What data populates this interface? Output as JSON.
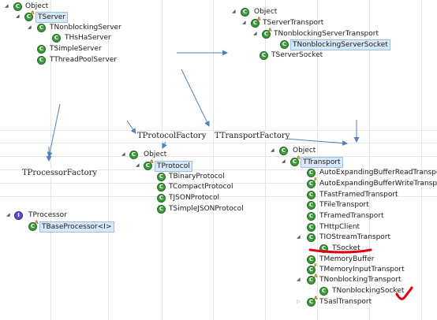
{
  "factories": {
    "protocol": "TProtocolFactory",
    "transport": "TTransportFactory",
    "processor": "TProcessorFactory"
  },
  "trees": {
    "server": [
      {
        "label": "Object",
        "icon": "class"
      },
      {
        "label": "TServer",
        "icon": "class",
        "sub": "A",
        "selected": true
      },
      {
        "label": "TNonblockingServer",
        "icon": "class"
      },
      {
        "label": "THsHaServer",
        "icon": "class"
      },
      {
        "label": "TSimpleServer",
        "icon": "class"
      },
      {
        "label": "TThreadPoolServer",
        "icon": "class"
      }
    ],
    "server_transport": [
      {
        "label": "Object",
        "icon": "class"
      },
      {
        "label": "TServerTransport",
        "icon": "class",
        "sub": "A"
      },
      {
        "label": "TNonblockingServerTransport",
        "icon": "class",
        "sub": "A"
      },
      {
        "label": "TNonblockingServerSocket",
        "icon": "class",
        "selected": true
      },
      {
        "label": "TServerSocket",
        "icon": "class"
      }
    ],
    "protocol": [
      {
        "label": "Object",
        "icon": "class"
      },
      {
        "label": "TProtocol",
        "icon": "class",
        "sub": "A",
        "selected": true
      },
      {
        "label": "TBinaryProtocol",
        "icon": "class"
      },
      {
        "label": "TCompactProtocol",
        "icon": "class"
      },
      {
        "label": "TJSONProtocol",
        "icon": "class"
      },
      {
        "label": "TSimpleJSONProtocol",
        "icon": "class"
      }
    ],
    "processor": [
      {
        "label": "TProcessor",
        "icon": "interface"
      },
      {
        "label": "TBaseProcessor<I>",
        "icon": "class",
        "sub": "A",
        "selected": true
      }
    ],
    "transport": [
      {
        "label": "Object",
        "icon": "class"
      },
      {
        "label": "TTransport",
        "icon": "class",
        "sub": "A",
        "selected": true
      },
      {
        "label": "AutoExpandingBufferReadTransport",
        "icon": "class"
      },
      {
        "label": "AutoExpandingBufferWriteTransport",
        "icon": "class",
        "sub": "F"
      },
      {
        "label": "TFastFramedTransport",
        "icon": "class"
      },
      {
        "label": "TFileTransport",
        "icon": "class"
      },
      {
        "label": "TFramedTransport",
        "icon": "class"
      },
      {
        "label": "THttpClient",
        "icon": "class"
      },
      {
        "label": "TIOStreamTransport",
        "icon": "class"
      },
      {
        "label": "TSocket",
        "icon": "class"
      },
      {
        "label": "TMemoryBuffer",
        "icon": "class"
      },
      {
        "label": "TMemoryInputTransport",
        "icon": "class",
        "sub": "F"
      },
      {
        "label": "TNonblockingTransport",
        "icon": "class",
        "sub": "A"
      },
      {
        "label": "TNonblockingSocket",
        "icon": "class"
      },
      {
        "label": "TSaslTransport",
        "icon": "class",
        "sub": "A"
      }
    ]
  },
  "colors": {
    "arrow": "#4f81bd",
    "annotation": "#e0000f",
    "selection": "#d8e8f8",
    "class_icon": "#3c9a3c",
    "interface_icon": "#5a4fc0"
  }
}
